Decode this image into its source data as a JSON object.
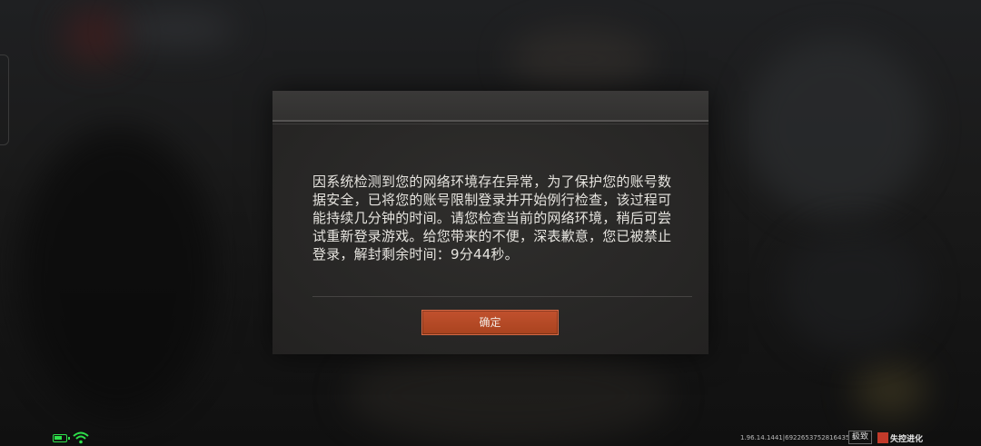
{
  "dialog": {
    "message": "因系统检测到您的网络环境存在异常，为了保护您的账号数据安全，已将您的账号限制登录并开始例行检查，该过程可能持续几分钟的时间。请您检查当前的网络环境，稍后可尝试重新登录游戏。给您带来的不便，深表歉意，您已被禁止登录，解封剩余时间：9分44秒。",
    "confirm_label": "确定"
  },
  "status_bar": {
    "battery_level": 0.7,
    "version": "1.96.14.1441|6922653752816435 3",
    "quality_label": "极致",
    "logo_text": "失控进化"
  },
  "colors": {
    "accent_button": "#b8492a",
    "battery": "#2ee04a",
    "dialog_bg": "#292827"
  },
  "icons": [
    "battery-icon",
    "wifi-icon"
  ]
}
